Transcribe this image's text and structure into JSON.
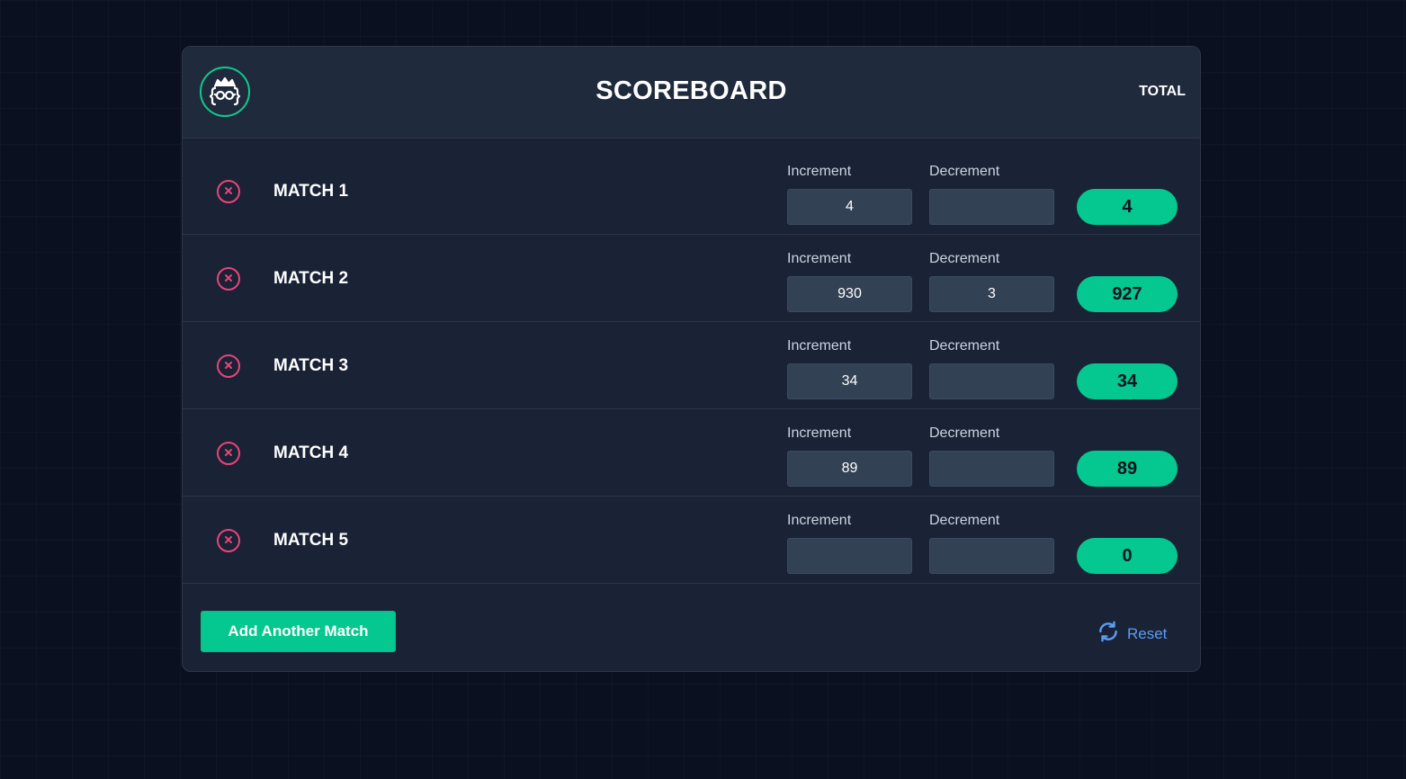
{
  "header": {
    "title": "SCOREBOARD",
    "total_label": "TOTAL",
    "logo_icon": "developer-face-icon"
  },
  "labels": {
    "increment": "Increment",
    "decrement": "Decrement"
  },
  "matches": [
    {
      "name": "MATCH 1",
      "increment": "4",
      "decrement": "",
      "total": "4"
    },
    {
      "name": "MATCH 2",
      "increment": "930",
      "decrement": "3",
      "total": "927"
    },
    {
      "name": "MATCH 3",
      "increment": "34",
      "decrement": "",
      "total": "34"
    },
    {
      "name": "MATCH 4",
      "increment": "89",
      "decrement": "",
      "total": "89"
    },
    {
      "name": "MATCH 5",
      "increment": "",
      "decrement": "",
      "total": "0"
    }
  ],
  "footer": {
    "add_button": "Add Another Match",
    "reset_button": "Reset"
  },
  "colors": {
    "accent": "#04c88f",
    "danger": "#e8457a",
    "link": "#5b9cf4",
    "panel": "#1a2235",
    "background": "#0a1020"
  }
}
